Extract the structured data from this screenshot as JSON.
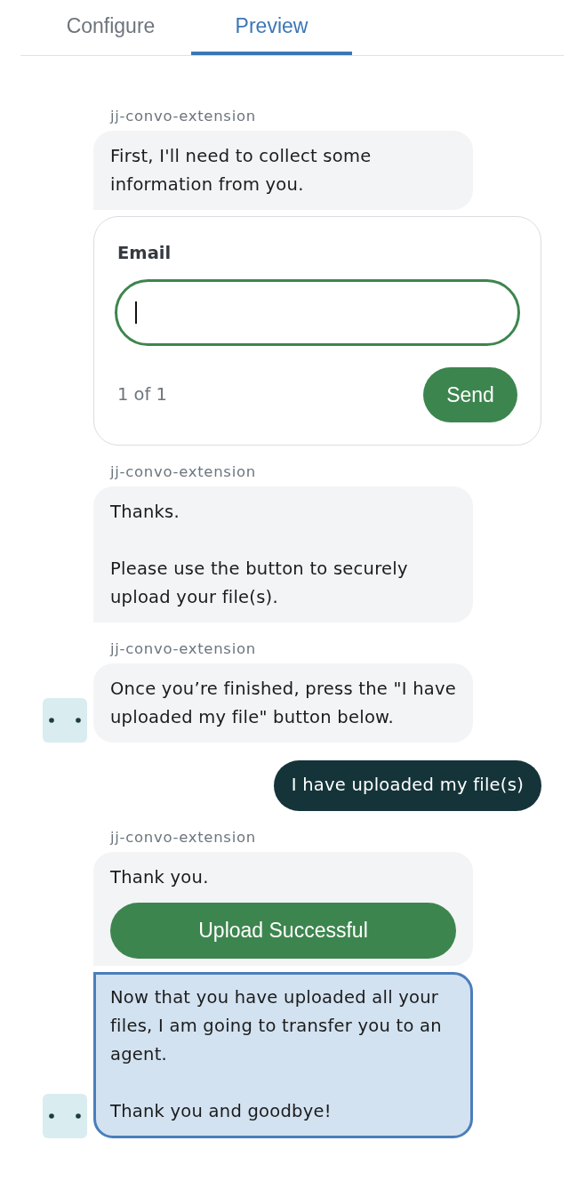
{
  "tabs": [
    {
      "label": "Configure",
      "selected": false
    },
    {
      "label": "Preview",
      "selected": true
    }
  ],
  "messages": [
    {
      "kind": "bot",
      "sender": "jj-convo-extension",
      "avatar": false,
      "items": [
        {
          "kind": "bubble",
          "selected": false,
          "paragraphs": [
            "First, I'll need to collect some information from you."
          ]
        },
        {
          "kind": "form",
          "field": {
            "label": "Email",
            "focused": true
          },
          "counter": "1 of 1",
          "button": "Send"
        }
      ]
    },
    {
      "kind": "bot",
      "sender": "jj-convo-extension",
      "avatar": false,
      "items": [
        {
          "kind": "bubble",
          "selected": false,
          "paragraphs": [
            "Thanks.",
            "Please use the button to securely upload your file(s)."
          ]
        }
      ]
    },
    {
      "kind": "bot",
      "sender": "jj-convo-extension",
      "avatar": true,
      "items": [
        {
          "kind": "bubble",
          "selected": false,
          "paragraphs": [
            "Once you’re finished, press the \"I have uploaded my file\" button below."
          ]
        }
      ]
    },
    {
      "kind": "user",
      "text": "I have uploaded my file(s)"
    },
    {
      "kind": "bot",
      "sender": "jj-convo-extension",
      "avatar": true,
      "items": [
        {
          "kind": "bubble",
          "selected": false,
          "paragraphs": [
            "Thank you."
          ],
          "button": "Upload Successful"
        },
        {
          "kind": "bubble",
          "selected": true,
          "paragraphs": [
            "Now that you have uploaded all your files, I am going to transfer you to an agent.",
            "Thank you and goodbye!"
          ]
        }
      ]
    }
  ]
}
